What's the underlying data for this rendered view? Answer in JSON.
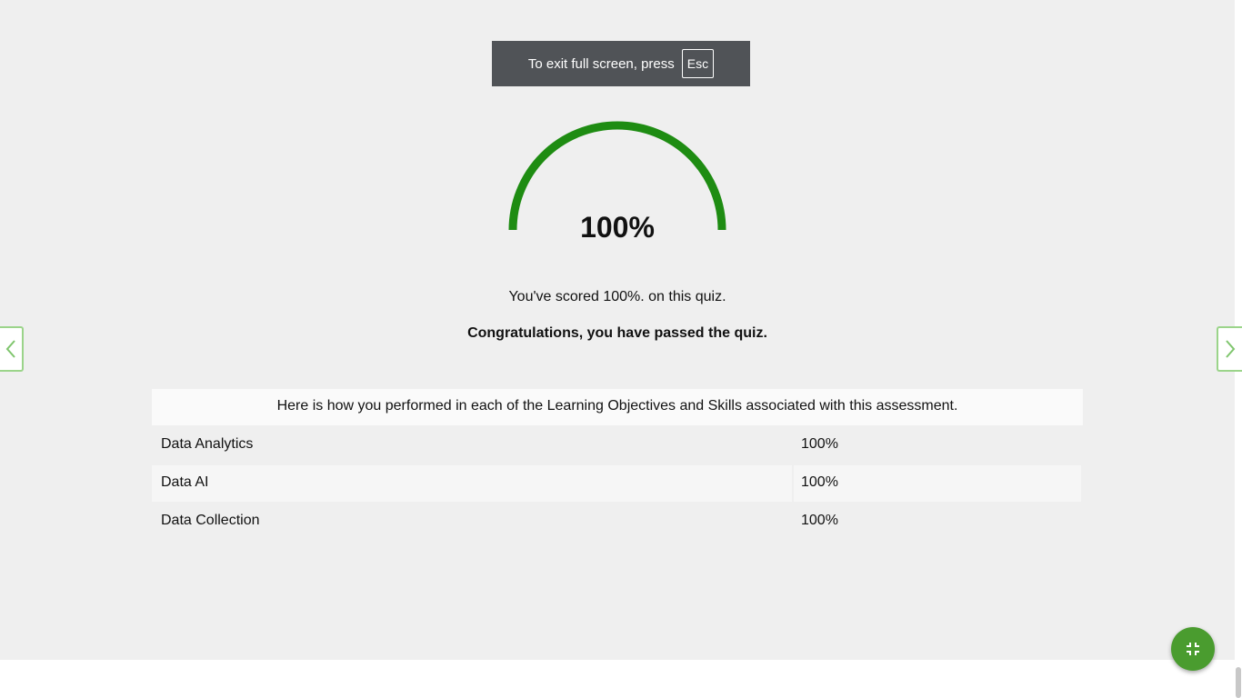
{
  "fullscreen_toast": {
    "message": "To exit full screen, press",
    "key_label": "Esc"
  },
  "result": {
    "score_percent": 100,
    "score_label": "100%",
    "score_message": "You've scored 100%. on this quiz.",
    "pass_message": "Congratulations, you have passed the quiz."
  },
  "objectives": {
    "header": "Here is how you performed in each of the Learning Objectives and Skills associated with this assessment.",
    "rows": [
      {
        "name": "Data Analytics",
        "value": "100%"
      },
      {
        "name": "Data AI",
        "value": "100%"
      },
      {
        "name": "Data Collection",
        "value": "100%"
      }
    ]
  },
  "icons": {
    "prev": "chevron-left-icon",
    "next": "chevron-right-icon",
    "exit_fullscreen": "exit-fullscreen-icon"
  },
  "colors": {
    "gauge": "#1e8c12",
    "accent_button": "#4a9c2f",
    "nav_border": "#9bd48a",
    "toast_bg": "#505357"
  }
}
